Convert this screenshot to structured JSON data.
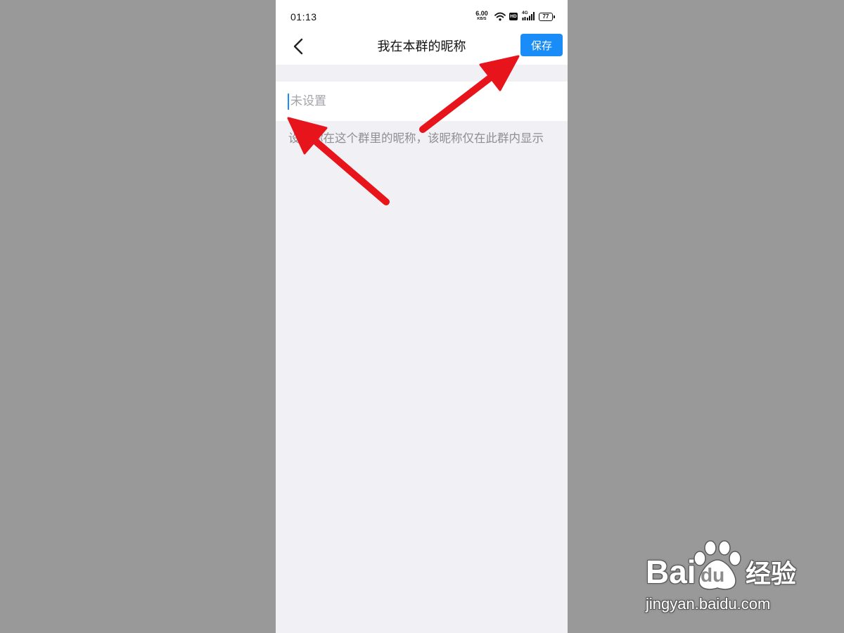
{
  "status_bar": {
    "time": "01:13",
    "net_speed_value": "6.00",
    "net_speed_unit": "KB/S",
    "hd_label": "HD",
    "network_label": "4G",
    "battery": "77"
  },
  "header": {
    "title": "我在本群的昵称",
    "save_label": "保存"
  },
  "nickname_input": {
    "placeholder": "未设置",
    "value": ""
  },
  "hint": "设置你在这个群里的昵称，该昵称仅在此群内显示",
  "watermark": {
    "brand_left": "Bai",
    "brand_paw": "du",
    "brand_right": "经验",
    "url": "jingyan.baidu.com"
  },
  "icons": {
    "back": "chevron-left-icon",
    "wifi": "wifi-icon",
    "signal": "cell-signal-icon",
    "battery": "battery-icon",
    "annotation": "red-arrow"
  },
  "colors": {
    "accent": "#1a8cf7",
    "annotation_arrow": "#e8141c",
    "page_background": "#f0f0f5",
    "backdrop": "#999999"
  }
}
